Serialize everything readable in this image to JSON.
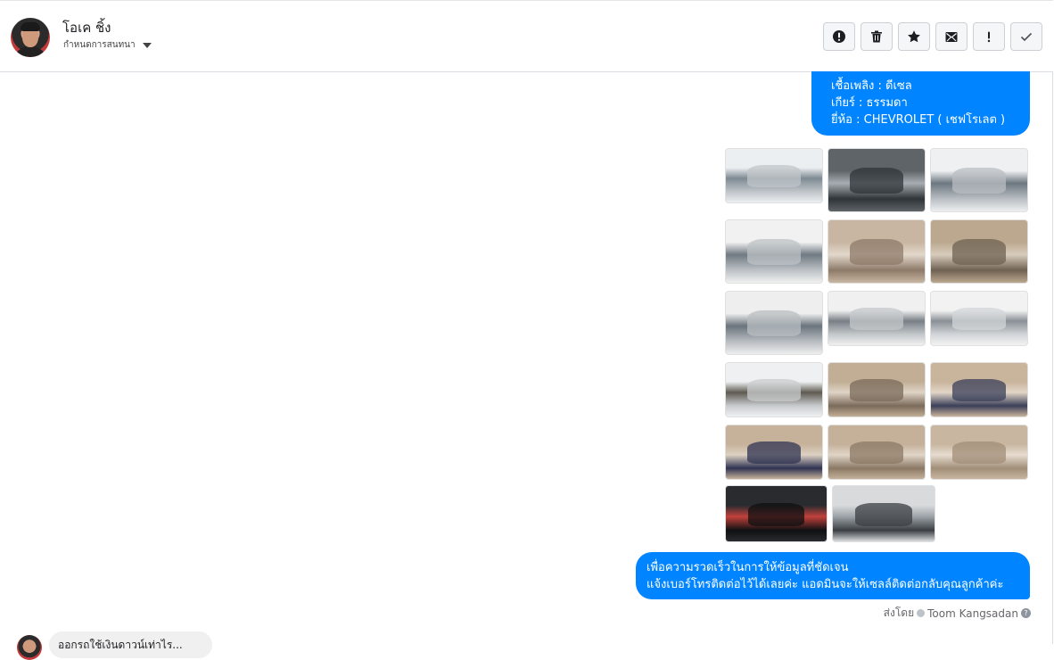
{
  "conversation": {
    "contact_name": "โอเค ชิ้ง",
    "assign_label": "กำหนดการสนทนา"
  },
  "toolbar": {
    "buttons": [
      {
        "name": "mark-spam",
        "icon": "exclamation-circle-icon"
      },
      {
        "name": "delete",
        "icon": "trash-icon"
      },
      {
        "name": "star",
        "icon": "star-icon"
      },
      {
        "name": "mark-unread",
        "icon": "envelope-icon"
      },
      {
        "name": "important",
        "icon": "exclamation-icon"
      },
      {
        "name": "mark-done",
        "icon": "check-icon"
      }
    ]
  },
  "messages": {
    "specs": {
      "line1": "เชื้อเพลิง : ดีเซล",
      "line2": "เกียร์ : ธรรมดา",
      "line3": "ยี่ห้อ : CHEVROLET ( เชฟโรเลต )"
    },
    "photos": [
      {
        "subject": "pickup-front-left"
      },
      {
        "subject": "engine-bay"
      },
      {
        "subject": "pickup-front-right"
      },
      {
        "subject": "pickup-front"
      },
      {
        "subject": "interior-front-seat"
      },
      {
        "subject": "door-panel"
      },
      {
        "subject": "pickup-front-left-2"
      },
      {
        "subject": "pickup-side-front"
      },
      {
        "subject": "pickup-side"
      },
      {
        "subject": "wheel-closeup"
      },
      {
        "subject": "door-panel-2"
      },
      {
        "subject": "steering-wheel"
      },
      {
        "subject": "steering-wheel-2"
      },
      {
        "subject": "interior-seats"
      },
      {
        "subject": "rear-seat"
      },
      {
        "subject": "dashboard-gauges"
      },
      {
        "subject": "engine-bay-2"
      }
    ],
    "closing": {
      "line1": "เพื่อความรวดเร็วในการให้ข้อมูลที่ชัดเจน",
      "line2": "แจ้งเบอร์โทรติดต่อไว้ได้เลยค่ะ แอดมินจะให้เซลล์ติดต่อกลับคุณลูกค้าค่ะ"
    },
    "sent_by_label": "ส่งโดย",
    "sent_by_name": "Toom Kangsadan",
    "incoming_preview": "ออกรถใช้เงินดาวน์เท่าไร..."
  },
  "colors": {
    "bubble": "#0084ff",
    "border": "#dadde1"
  }
}
